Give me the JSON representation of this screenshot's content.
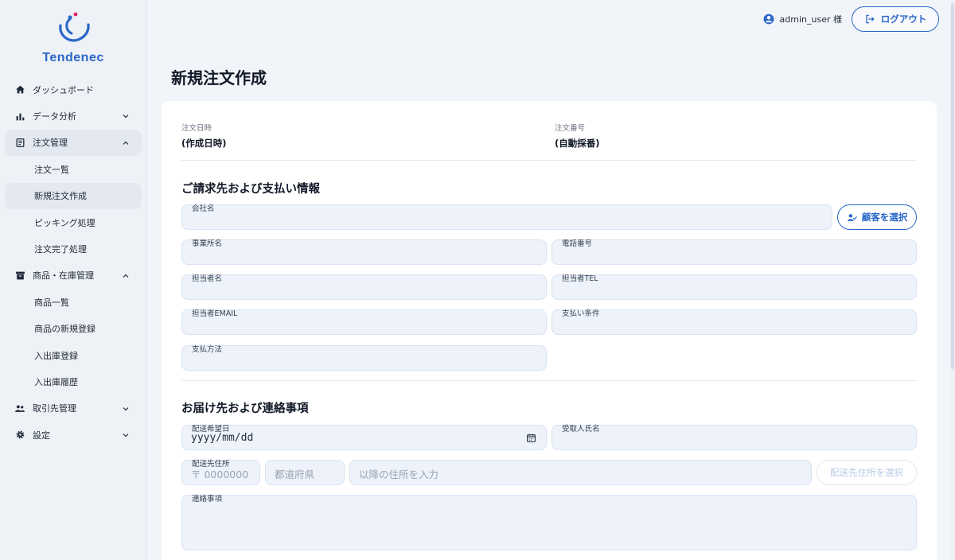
{
  "brand": {
    "name": "Tendenec"
  },
  "sidebar": {
    "items": [
      {
        "label": "ダッシュボード",
        "icon": "home-icon"
      },
      {
        "label": "データ分析",
        "icon": "bar-chart-icon"
      },
      {
        "label": "注文管理",
        "icon": "receipt-icon"
      },
      {
        "label": "注文一覧"
      },
      {
        "label": "新規注文作成"
      },
      {
        "label": "ピッキング処理"
      },
      {
        "label": "注文完了処理"
      },
      {
        "label": "商品・在庫管理",
        "icon": "archive-icon"
      },
      {
        "label": "商品一覧"
      },
      {
        "label": "商品の新規登録"
      },
      {
        "label": "入出庫登録"
      },
      {
        "label": "入出庫履歴"
      },
      {
        "label": "取引先管理",
        "icon": "people-icon"
      },
      {
        "label": "設定",
        "icon": "gear-icon"
      }
    ]
  },
  "header": {
    "user": "admin_user 様",
    "logout_label": "ログアウト"
  },
  "page": {
    "title": "新規注文作成"
  },
  "order_meta": {
    "date_label": "注文日時",
    "date_value": "(作成日時)",
    "number_label": "注文番号",
    "number_value": "(自動採番)"
  },
  "billing": {
    "title": "ご請求先および支払い情報",
    "company_label": "会社名",
    "select_customer_label": "顧客を選択",
    "office_label": "事業所名",
    "phone_label": "電話番号",
    "contact_label": "担当者名",
    "contact_tel_label": "担当者TEL",
    "contact_email_label": "担当者EMAIL",
    "payment_terms_label": "支払い条件",
    "payment_method_label": "支払方法"
  },
  "shipping": {
    "title": "お届け先および連絡事項",
    "delivery_date_label": "配送希望日",
    "delivery_date_value": "yyyy/mm/dd",
    "recipient_label": "受取人氏名",
    "address_label": "配送先住所",
    "postal_placeholder": "〒 0000000",
    "prefecture_placeholder": "都道府県",
    "address_placeholder": "以降の住所を入力",
    "select_address_label": "配送先住所を選択",
    "notes_label": "連絡事項"
  },
  "colors": {
    "accent": "#2a67c8",
    "field_bg": "#edf2fb",
    "sidebar_bg": "#eef1f6"
  }
}
